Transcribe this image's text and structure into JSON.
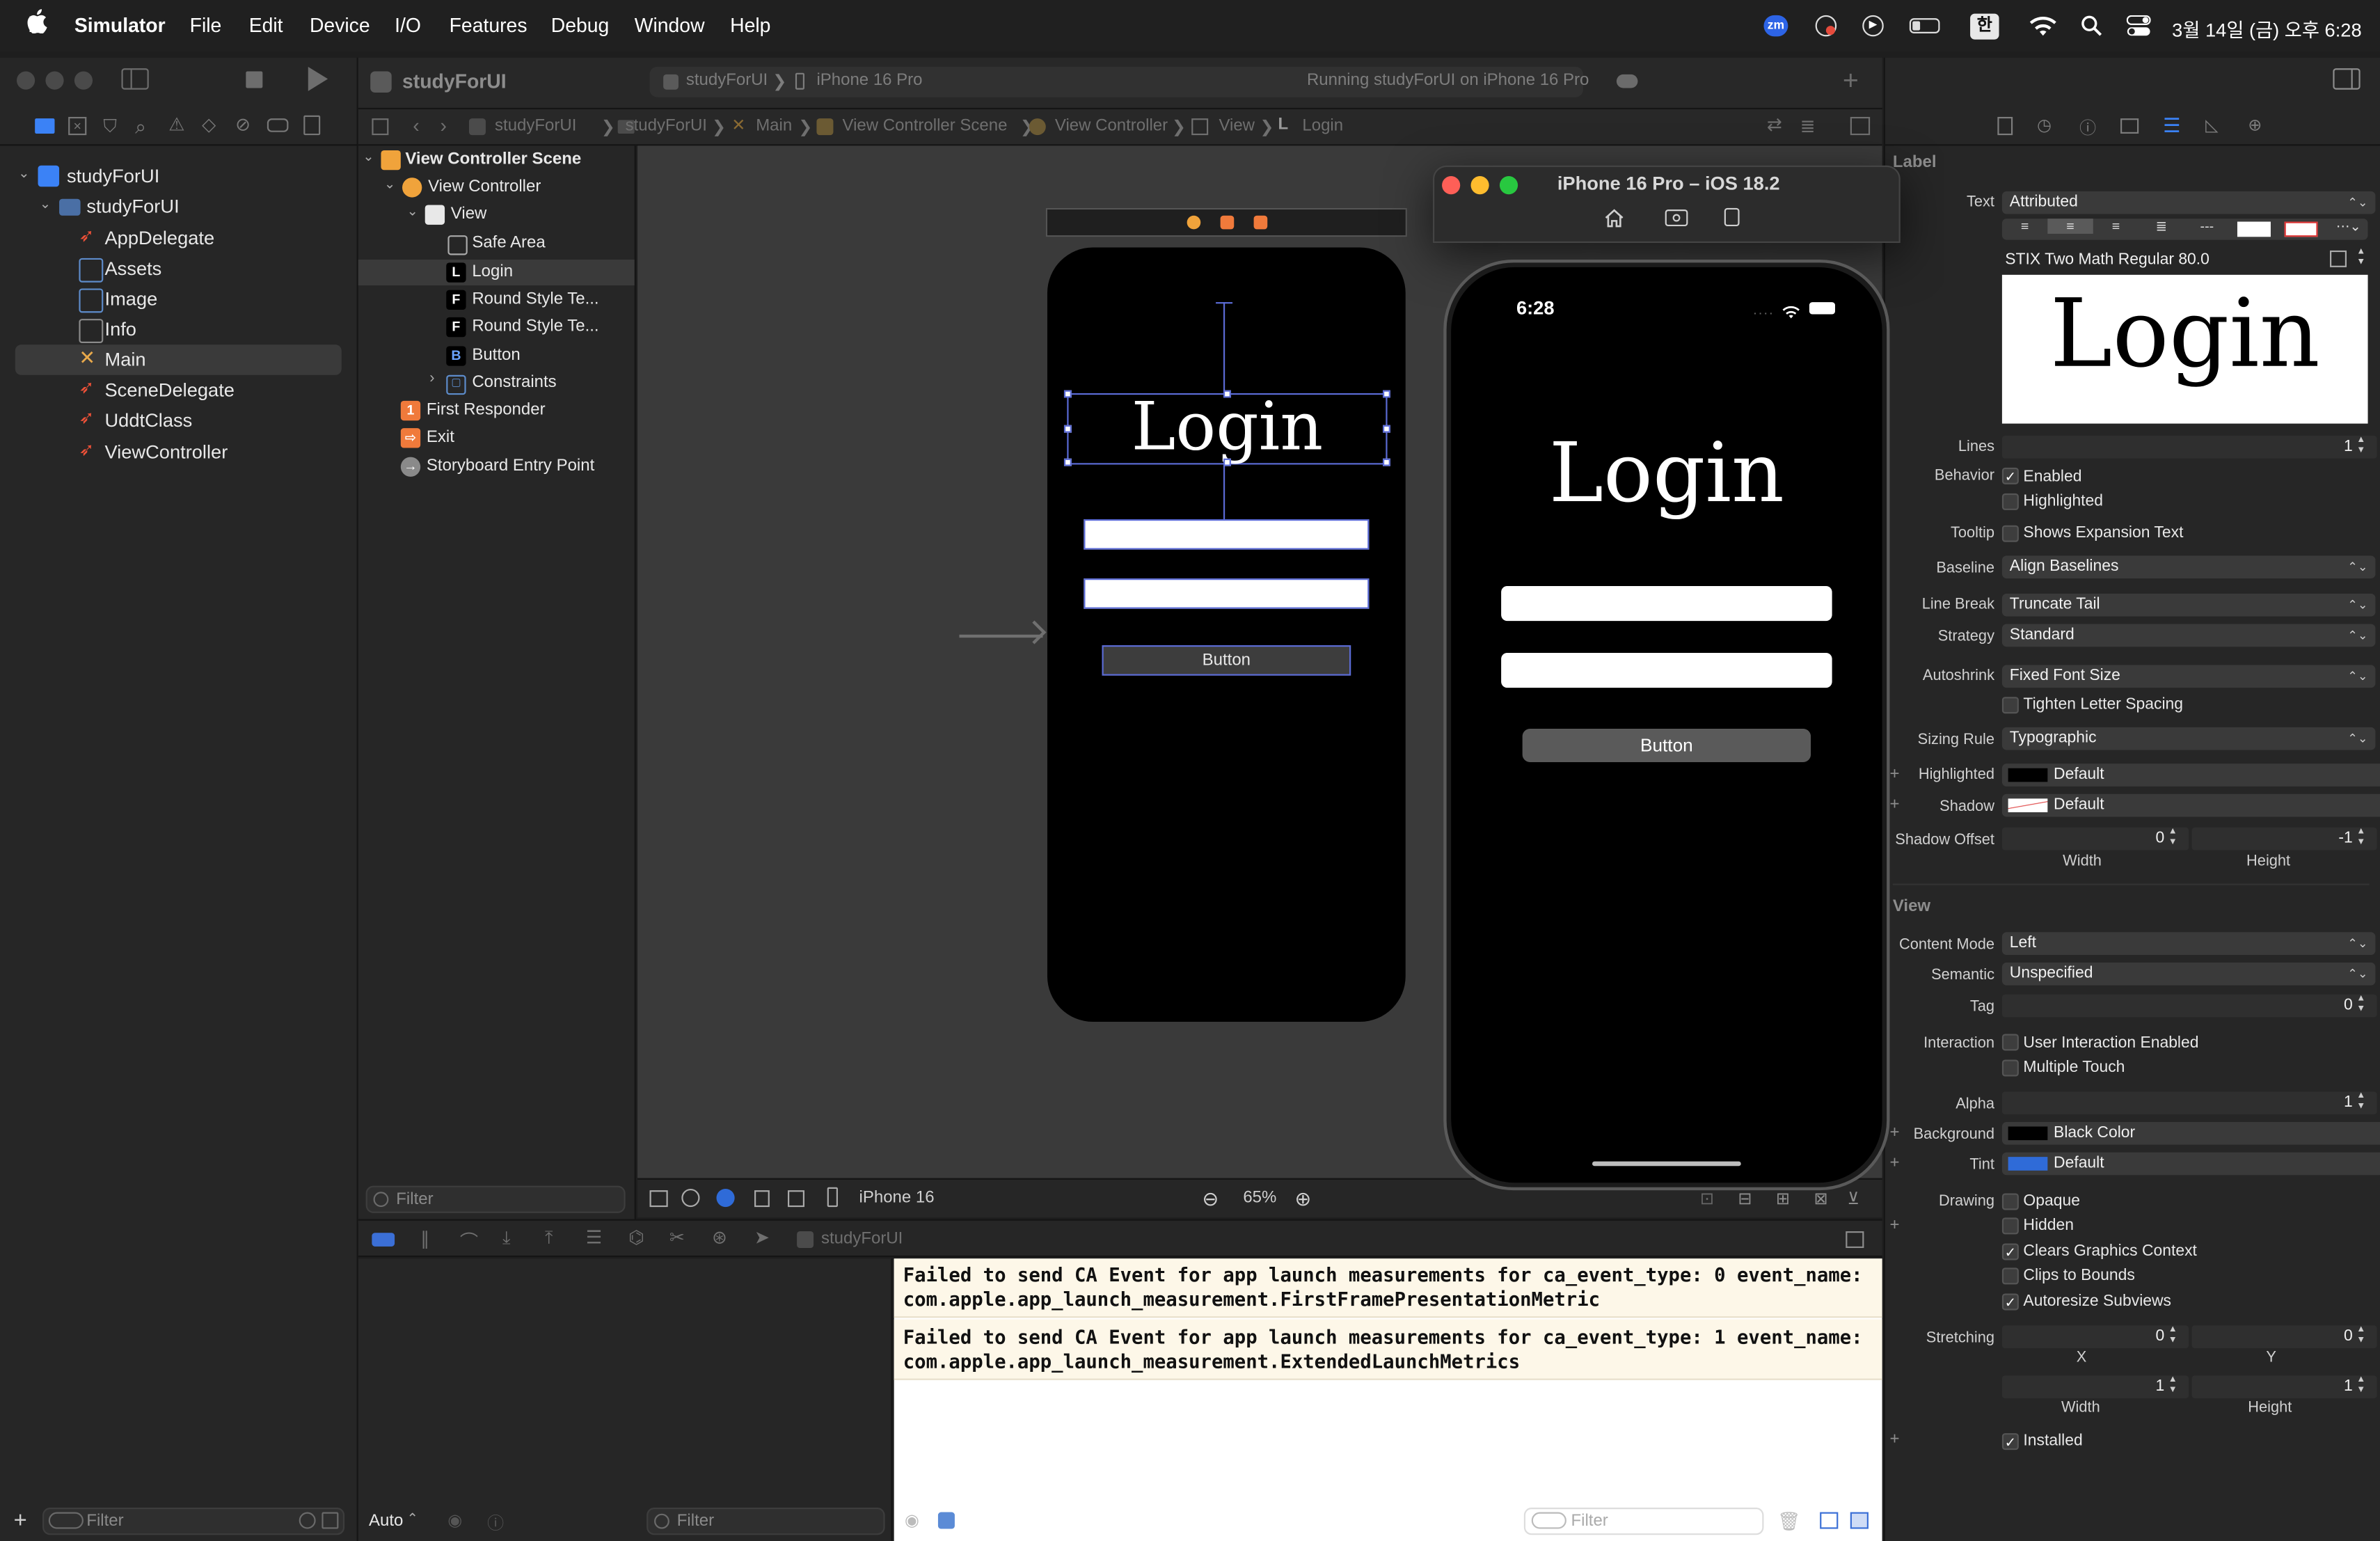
{
  "menubar": {
    "app_name": "Simulator",
    "items": [
      "File",
      "Edit",
      "Device",
      "I/O",
      "Features",
      "Debug",
      "Window",
      "Help"
    ],
    "datetime": "3월 14일 (금) 오후 6:28",
    "input_lang": "한",
    "zoom_badge": "zm"
  },
  "toolbar": {
    "project_name": "studyForUI",
    "scheme_target": "studyForUI",
    "destination": "iPhone 16 Pro",
    "status": "Running studyForUI on iPhone 16 Pro"
  },
  "jumpbar": {
    "items": [
      "studyForUI",
      "studyForUI",
      "Main",
      "View Controller Scene",
      "View Controller",
      "View",
      "Login"
    ]
  },
  "navigator": {
    "items": [
      {
        "label": "studyForUI",
        "level": 0,
        "kind": "project"
      },
      {
        "label": "studyForUI",
        "level": 1,
        "kind": "folder"
      },
      {
        "label": "AppDelegate",
        "level": 2,
        "kind": "swift"
      },
      {
        "label": "Assets",
        "level": 2,
        "kind": "assets"
      },
      {
        "label": "Image",
        "level": 2,
        "kind": "image"
      },
      {
        "label": "Info",
        "level": 2,
        "kind": "plist"
      },
      {
        "label": "Main",
        "level": 2,
        "kind": "storyboard"
      },
      {
        "label": "SceneDelegate",
        "level": 2,
        "kind": "swift"
      },
      {
        "label": "UddtClass",
        "level": 2,
        "kind": "swift"
      },
      {
        "label": "ViewController",
        "level": 2,
        "kind": "swift"
      }
    ],
    "selected": "Main",
    "filter_placeholder": "Filter"
  },
  "outline": {
    "items": [
      {
        "label": "View Controller Scene",
        "level": 0,
        "icon": "scene"
      },
      {
        "label": "View Controller",
        "level": 1,
        "icon": "vc"
      },
      {
        "label": "View",
        "level": 2,
        "icon": "view"
      },
      {
        "label": "Safe Area",
        "level": 3,
        "icon": "safe"
      },
      {
        "label": "Login",
        "level": 3,
        "icon": "L"
      },
      {
        "label": "Round Style Te...",
        "level": 3,
        "icon": "F"
      },
      {
        "label": "Round Style Te...",
        "level": 3,
        "icon": "F"
      },
      {
        "label": "Button",
        "level": 3,
        "icon": "B"
      },
      {
        "label": "Constraints",
        "level": 3,
        "icon": "constraints"
      },
      {
        "label": "First Responder",
        "level": 0,
        "icon": "responder"
      },
      {
        "label": "Exit",
        "level": 0,
        "icon": "exit"
      },
      {
        "label": "Storyboard Entry Point",
        "level": 0,
        "icon": "entry"
      }
    ],
    "selected": "Login",
    "filter_placeholder": "Filter"
  },
  "canvas": {
    "label_text": "Login",
    "button_text": "Button",
    "device": "iPhone 16",
    "zoom": "65%"
  },
  "simulator": {
    "title": "iPhone 16 Pro – iOS 18.2",
    "time": "6:28",
    "label_text": "Login",
    "button_text": "Button"
  },
  "debug": {
    "target": "studyForUI",
    "auto": "Auto",
    "filter_placeholder": "Filter",
    "console_lines": [
      "Failed to send CA Event for app launch measurements for ca_event_type: 0 event_name:",
      "com.apple.app_launch_measurement.FirstFramePresentationMetric",
      "Failed to send CA Event for app launch measurements for ca_event_type: 1 event_name:",
      "com.apple.app_launch_measurement.ExtendedLaunchMetrics"
    ],
    "console_filter_placeholder": "Filter"
  },
  "inspector": {
    "section_label": "Label",
    "text_label": "Text",
    "text_value": "Attributed",
    "font_value": "STIX Two Math Regular 80.0",
    "preview_text": "Login",
    "lines_label": "Lines",
    "lines_value": "1",
    "behavior_label": "Behavior",
    "enabled": "Enabled",
    "highlighted_cb": "Highlighted",
    "tooltip_label": "Tooltip",
    "tooltip_value": "Shows Expansion Text",
    "baseline_label": "Baseline",
    "baseline_value": "Align Baselines",
    "linebreak_label": "Line Break",
    "linebreak_value": "Truncate Tail",
    "strategy_label": "Strategy",
    "strategy_value": "Standard",
    "autoshrink_label": "Autoshrink",
    "autoshrink_value": "Fixed Font Size",
    "tighten": "Tighten Letter Spacing",
    "sizing_label": "Sizing Rule",
    "sizing_value": "Typographic",
    "highlighted_label": "Highlighted",
    "highlighted_value": "Default",
    "shadow_label": "Shadow",
    "shadow_value": "Default",
    "shadow_offset_label": "Shadow Offset",
    "shadow_w": "0",
    "shadow_h": "-1",
    "width_caption": "Width",
    "height_caption": "Height",
    "view_section": "View",
    "content_mode_label": "Content Mode",
    "content_mode_value": "Left",
    "semantic_label": "Semantic",
    "semantic_value": "Unspecified",
    "tag_label": "Tag",
    "tag_value": "0",
    "interaction_label": "Interaction",
    "user_interaction": "User Interaction Enabled",
    "multiple_touch": "Multiple Touch",
    "alpha_label": "Alpha",
    "alpha_value": "1",
    "background_label": "Background",
    "background_value": "Black Color",
    "tint_label": "Tint",
    "tint_value": "Default",
    "drawing_label": "Drawing",
    "opaque": "Opaque",
    "hidden": "Hidden",
    "clears": "Clears Graphics Context",
    "clips": "Clips to Bounds",
    "autoresize": "Autoresize Subviews",
    "stretching_label": "Stretching",
    "stretch_x": "0",
    "stretch_y": "0",
    "stretch_w": "1",
    "stretch_h": "1",
    "x_caption": "X",
    "y_caption": "Y",
    "installed": "Installed"
  },
  "colors": {
    "accent": "#2f6bd8",
    "panel": "#262626",
    "canvas": "#3a3a3a",
    "console_bg": "#fdf7e8"
  }
}
